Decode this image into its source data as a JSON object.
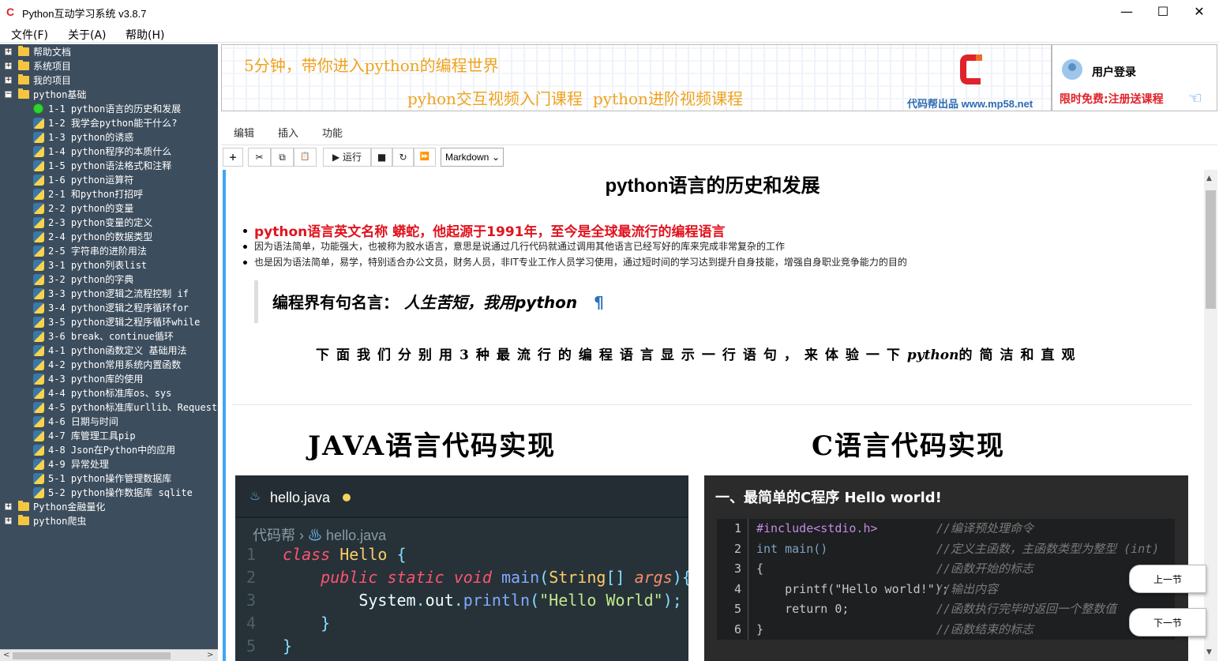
{
  "window": {
    "title": "Python互动学习系统 v3.8.7",
    "minimize": "—",
    "maximize": "☐",
    "close": "✕"
  },
  "menu": [
    "文件(F)",
    "关于(A)",
    "帮助(H)"
  ],
  "tree": [
    {
      "label": "帮助文档",
      "type": "folder",
      "expander": "+"
    },
    {
      "label": "系统项目",
      "type": "folder",
      "expander": "+"
    },
    {
      "label": "我的项目",
      "type": "folder",
      "expander": "+"
    },
    {
      "label": "python基础",
      "type": "folder",
      "expander": "−"
    },
    {
      "label": "1-1 python语言的历史和发展",
      "type": "current"
    },
    {
      "label": "1-2 我学会python能干什么?",
      "type": "lesson"
    },
    {
      "label": "1-3 python的诱惑",
      "type": "lesson"
    },
    {
      "label": "1-4 python程序的本质什么",
      "type": "lesson"
    },
    {
      "label": "1-5 python语法格式和注释",
      "type": "lesson"
    },
    {
      "label": "1-6 python运算符",
      "type": "lesson"
    },
    {
      "label": "2-1 和python打招呼",
      "type": "lesson"
    },
    {
      "label": "2-2 python的变量",
      "type": "lesson"
    },
    {
      "label": "2-3 python变量的定义",
      "type": "lesson"
    },
    {
      "label": "2-4 python的数据类型",
      "type": "lesson"
    },
    {
      "label": "2-5 字符串的进阶用法",
      "type": "lesson"
    },
    {
      "label": "3-1 python列表list",
      "type": "lesson"
    },
    {
      "label": "3-2 python的字典",
      "type": "lesson"
    },
    {
      "label": "3-3 python逻辑之流程控制 if",
      "type": "lesson"
    },
    {
      "label": "3-4 python逻辑之程序循环for",
      "type": "lesson"
    },
    {
      "label": "3-5 python逻辑之程序循环while",
      "type": "lesson"
    },
    {
      "label": "3-6 break、continue循环",
      "type": "lesson"
    },
    {
      "label": "4-1 python函数定义 基础用法",
      "type": "lesson"
    },
    {
      "label": "4-2 python常用系统内置函数",
      "type": "lesson"
    },
    {
      "label": "4-3 python库的使用",
      "type": "lesson"
    },
    {
      "label": "4-4 python标准库os、sys",
      "type": "lesson"
    },
    {
      "label": "4-5 python标准库urllib、Request",
      "type": "lesson"
    },
    {
      "label": "4-6 日期与时间",
      "type": "lesson"
    },
    {
      "label": "4-7 库管理工具pip",
      "type": "lesson"
    },
    {
      "label": "4-8 Json在Python中的应用",
      "type": "lesson"
    },
    {
      "label": "4-9 异常处理",
      "type": "lesson"
    },
    {
      "label": "5-1 python操作管理数据库",
      "type": "lesson"
    },
    {
      "label": "5-2 python操作数据库 sqlite",
      "type": "lesson"
    },
    {
      "label": "Python金融量化",
      "type": "folder",
      "expander": "+"
    },
    {
      "label": "python爬虫",
      "type": "folder",
      "expander": "+"
    }
  ],
  "banner": {
    "headline": "5分钟，带你进入python的编程世界",
    "link1": "pyhon交互视频入门课程",
    "link2": "python进阶视频课程",
    "site": "代码帮出品 www.mp58.net"
  },
  "user": {
    "login": "用户登录",
    "promo": "限时免费:注册送课程"
  },
  "tabs": [
    "编辑",
    "插入",
    "功能"
  ],
  "toolbar": {
    "add": "+",
    "cut": "✂",
    "copy": "⧉",
    "paste": "📋",
    "run": "▶ 运行",
    "stop": "■",
    "restart": "↻",
    "fast_forward": "⏩",
    "cell_type": "Markdown"
  },
  "doc": {
    "title": "python语言的历史和发展",
    "bullet1": "python语言英文名称 蟒蛇，他起源于1991年，至今是全球最流行的编程语言",
    "bullet2": "因为语法简单，功能强大，也被称为胶水语言，意思是说通过几行代码就通过调用其他语言已经写好的库来完成非常复杂的工作",
    "bullet3": "也是因为语法简单，易学，特别适合办公文员，财务人员，非IT专业工作人员学习使用，通过短时间的学习达到提升自身技能，增强自身职业竞争能力的目的",
    "quote_lead": "编程界有句名言：",
    "quote_em": "人生苦短，我用python",
    "pilcrow": "¶",
    "intro_a": "下面我们分别用3种最流行的编程语言显示一行语句，来体验一下",
    "intro_em": "python",
    "intro_b": "的简洁和直观",
    "java_heading": "JAVA语言代码实现",
    "c_heading": "C语言代码实现"
  },
  "java_code": {
    "tab": "hello.java",
    "breadcrumb_root": "代码帮",
    "breadcrumb_file": "hello.java",
    "line_numbers": [
      "1",
      "2",
      "3",
      "4",
      "5"
    ],
    "l1_kw": "class",
    "l1_cls": "Hello",
    "l1_brace": "{",
    "l2_public": "public",
    "l2_static": "static",
    "l2_void": "void",
    "l2_main": "main",
    "l2_open": "(",
    "l2_type": "String",
    "l2_arr": "[]",
    "l2_args": "args",
    "l2_close": "){",
    "l3_sys": "System",
    "l3_dot1": ".",
    "l3_out": "out",
    "l3_dot2": ".",
    "l3_println": "println",
    "l3_open": "(",
    "l3_str": "\"Hello World\"",
    "l3_close": ");",
    "l4": "}",
    "l5": "}"
  },
  "c_code": {
    "title": "一、最简单的C程序 Hello world!",
    "lines": [
      {
        "n": "1",
        "code": "#include<stdio.h>",
        "comment": "//编译预处理命令"
      },
      {
        "n": "2",
        "code": "int main()",
        "comment": "//定义主函数，主函数类型为整型 (int)"
      },
      {
        "n": "3",
        "code": "{",
        "comment": "//函数开始的标志"
      },
      {
        "n": "4",
        "code": "    printf(\"Hello world!\");",
        "comment": "//输出内容"
      },
      {
        "n": "5",
        "code": "    return 0;",
        "comment": "//函数执行完毕时返回一个整数值"
      },
      {
        "n": "6",
        "code": "}",
        "comment": "//函数结束的标志"
      }
    ]
  },
  "nav": {
    "prev": "上一节",
    "next": "下一节"
  },
  "colors": {
    "sidebar_bg": "#3c4d5d",
    "accent_red": "#e0141e",
    "banner_orange": "#f0a21e",
    "cell_bar": "#42a5f5"
  }
}
